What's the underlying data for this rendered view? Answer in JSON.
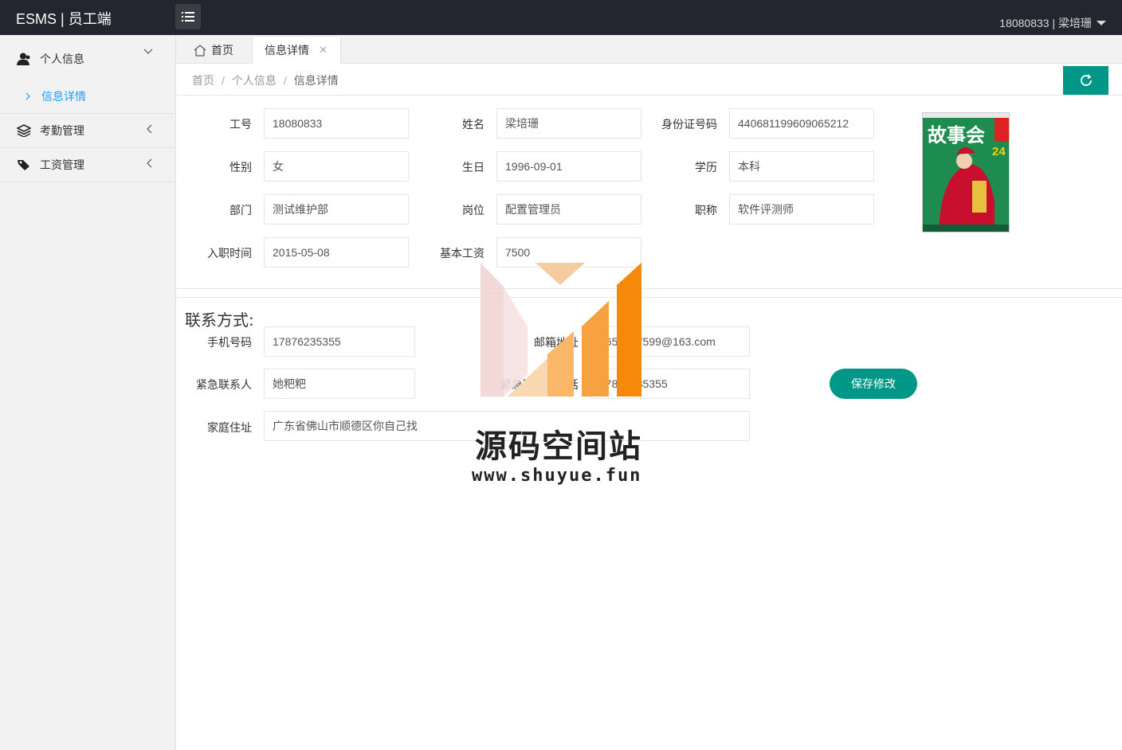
{
  "header": {
    "brand": "ESMS | 员工端",
    "user": "18080833 | 梁培珊"
  },
  "sidebar": {
    "items": [
      {
        "label": "个人信息",
        "icon": "user-icon",
        "expanded": true,
        "children": [
          {
            "label": "信息详情"
          }
        ]
      },
      {
        "label": "考勤管理",
        "icon": "layers-icon",
        "expanded": false
      },
      {
        "label": "工资管理",
        "icon": "tag-icon",
        "expanded": false
      }
    ]
  },
  "tabs": [
    {
      "label": "首页",
      "icon": "home-icon"
    },
    {
      "label": "信息详情",
      "active": true
    }
  ],
  "breadcrumb": {
    "items": [
      "首页",
      "个人信息",
      "信息详情"
    ]
  },
  "basic_info": {
    "employee_id": {
      "label": "工号",
      "value": "18080833"
    },
    "name": {
      "label": "姓名",
      "value": "梁培珊"
    },
    "id_card": {
      "label": "身份证号码",
      "value": "440681199609065212"
    },
    "gender": {
      "label": "性别",
      "value": "女"
    },
    "birthday": {
      "label": "生日",
      "value": "1996-09-01"
    },
    "education": {
      "label": "学历",
      "value": "本科"
    },
    "department": {
      "label": "部门",
      "value": "测试维护部"
    },
    "position": {
      "label": "岗位",
      "value": "配置管理员"
    },
    "title": {
      "label": "职称",
      "value": "软件评测师"
    },
    "hire_date": {
      "label": "入职时间",
      "value": "2015-05-08"
    },
    "base_salary": {
      "label": "基本工资",
      "value": "7500"
    }
  },
  "contact": {
    "section_title": "联系方式:",
    "phone": {
      "label": "手机号码",
      "value": "17876235355"
    },
    "email": {
      "label": "邮箱地址",
      "value": "1651707599@163.com"
    },
    "emergency_contact": {
      "label": "紧急联系人",
      "value": "她粑粑"
    },
    "emergency_phone": {
      "label": "紧急联系人电话",
      "value": "17876235355"
    },
    "address": {
      "label": "家庭住址",
      "value": "广东省佛山市顺德区你自己找"
    },
    "save_label": "保存修改"
  },
  "photo": {
    "title_text": "故事会",
    "issue": "24"
  },
  "watermark": {
    "title": "源码空间站",
    "url": "www.shuyue.fun"
  },
  "colors": {
    "header_bg": "#23262e",
    "accent": "#009688",
    "link": "#1e9fff"
  }
}
